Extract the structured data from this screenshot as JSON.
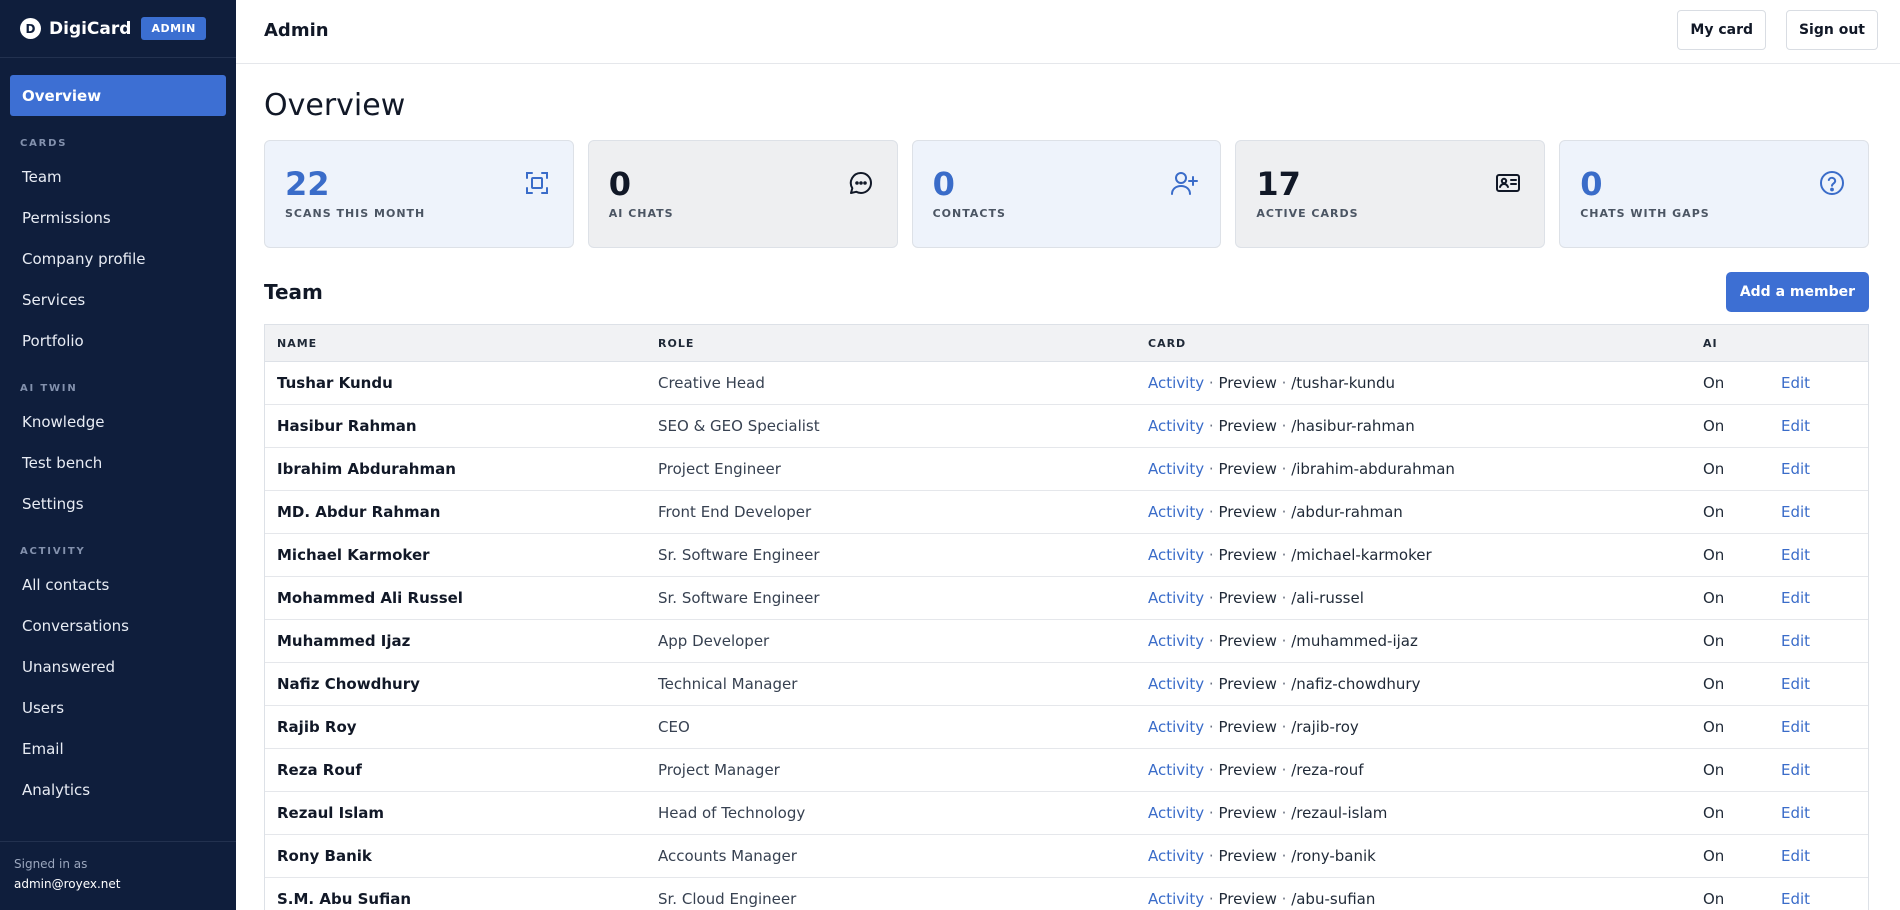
{
  "brand": {
    "logo_letter": "D",
    "name": "DigiCard",
    "badge": "ADMIN"
  },
  "sidebar": {
    "overview": "Overview",
    "sections": {
      "cards": "CARDS",
      "ai_twin": "AI TWIN",
      "activity": "ACTIVITY"
    },
    "cards_items": [
      "Team",
      "Permissions",
      "Company profile",
      "Services",
      "Portfolio"
    ],
    "ai_items": [
      "Knowledge",
      "Test bench",
      "Settings"
    ],
    "activity_items": [
      "All contacts",
      "Conversations",
      "Unanswered",
      "Users",
      "Email",
      "Analytics"
    ],
    "signed_in_label": "Signed in as",
    "signed_in_email": "admin@royex.net"
  },
  "header": {
    "title": "Admin",
    "my_card": "My card",
    "sign_out": "Sign out"
  },
  "page_title": "Overview",
  "stats": [
    {
      "value": "22",
      "label": "SCANS THIS MONTH",
      "icon": "scan-icon"
    },
    {
      "value": "0",
      "label": "AI CHATS",
      "icon": "chat-icon"
    },
    {
      "value": "0",
      "label": "CONTACTS",
      "icon": "add-user-icon"
    },
    {
      "value": "17",
      "label": "ACTIVE CARDS",
      "icon": "id-card-icon"
    },
    {
      "value": "0",
      "label": "CHATS WITH GAPS",
      "icon": "help-circle-icon"
    }
  ],
  "team": {
    "title": "Team",
    "add_button": "Add a member",
    "columns": {
      "name": "NAME",
      "role": "ROLE",
      "card": "CARD",
      "ai": "AI"
    },
    "link_activity": "Activity",
    "link_preview": "Preview",
    "link_edit": "Edit",
    "separator": "·",
    "rows": [
      {
        "name": "Tushar Kundu",
        "role": "Creative Head",
        "slug": "/tushar-kundu",
        "ai": "On"
      },
      {
        "name": "Hasibur Rahman",
        "role": "SEO & GEO Specialist",
        "slug": "/hasibur-rahman",
        "ai": "On"
      },
      {
        "name": "Ibrahim Abdurahman",
        "role": "Project Engineer",
        "slug": "/ibrahim-abdurahman",
        "ai": "On"
      },
      {
        "name": "MD. Abdur Rahman",
        "role": "Front End Developer",
        "slug": "/abdur-rahman",
        "ai": "On"
      },
      {
        "name": "Michael Karmoker",
        "role": "Sr. Software Engineer",
        "slug": "/michael-karmoker",
        "ai": "On"
      },
      {
        "name": "Mohammed Ali Russel",
        "role": "Sr. Software Engineer",
        "slug": "/ali-russel",
        "ai": "On"
      },
      {
        "name": "Muhammed Ijaz",
        "role": "App Developer",
        "slug": "/muhammed-ijaz",
        "ai": "On"
      },
      {
        "name": "Nafiz Chowdhury",
        "role": "Technical Manager",
        "slug": "/nafiz-chowdhury",
        "ai": "On"
      },
      {
        "name": "Rajib Roy",
        "role": "CEO",
        "slug": "/rajib-roy",
        "ai": "On"
      },
      {
        "name": "Reza Rouf",
        "role": "Project Manager",
        "slug": "/reza-rouf",
        "ai": "On"
      },
      {
        "name": "Rezaul Islam",
        "role": "Head of Technology",
        "slug": "/rezaul-islam",
        "ai": "On"
      },
      {
        "name": "Rony Banik",
        "role": "Accounts Manager",
        "slug": "/rony-banik",
        "ai": "On"
      },
      {
        "name": "S.M. Abu Sufian",
        "role": "Sr. Cloud Engineer",
        "slug": "/abu-sufian",
        "ai": "On"
      }
    ]
  },
  "colors": {
    "sidebar_bg": "#0f1e3c",
    "accent": "#3d6fd3",
    "link": "#3a6cc9"
  }
}
